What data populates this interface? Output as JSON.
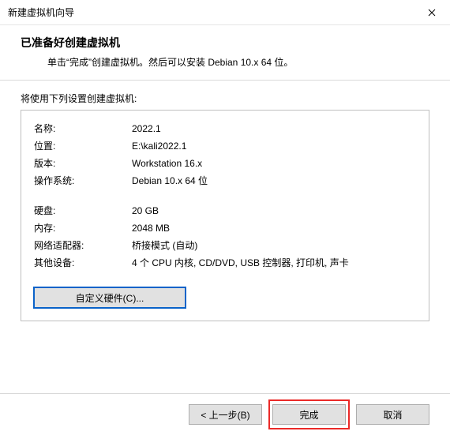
{
  "window": {
    "title": "新建虚拟机向导"
  },
  "header": {
    "heading": "已准备好创建虚拟机",
    "subtext": "单击“完成”创建虚拟机。然后可以安装 Debian 10.x 64 位。"
  },
  "section_label": "将使用下列设置创建虚拟机:",
  "info": {
    "name_label": "名称:",
    "name_value": "2022.1",
    "location_label": "位置:",
    "location_value": "E:\\kali2022.1",
    "version_label": "版本:",
    "version_value": "Workstation 16.x",
    "os_label": "操作系统:",
    "os_value": "Debian 10.x 64 位",
    "disk_label": "硬盘:",
    "disk_value": "20 GB",
    "memory_label": "内存:",
    "memory_value": "2048 MB",
    "net_label": "网络适配器:",
    "net_value": "桥接模式 (自动)",
    "other_label": "其他设备:",
    "other_value": "4 个 CPU 内核, CD/DVD, USB 控制器, 打印机, 声卡"
  },
  "buttons": {
    "customize": "自定义硬件(C)...",
    "back": "< 上一步(B)",
    "finish": "完成",
    "cancel": "取消"
  }
}
